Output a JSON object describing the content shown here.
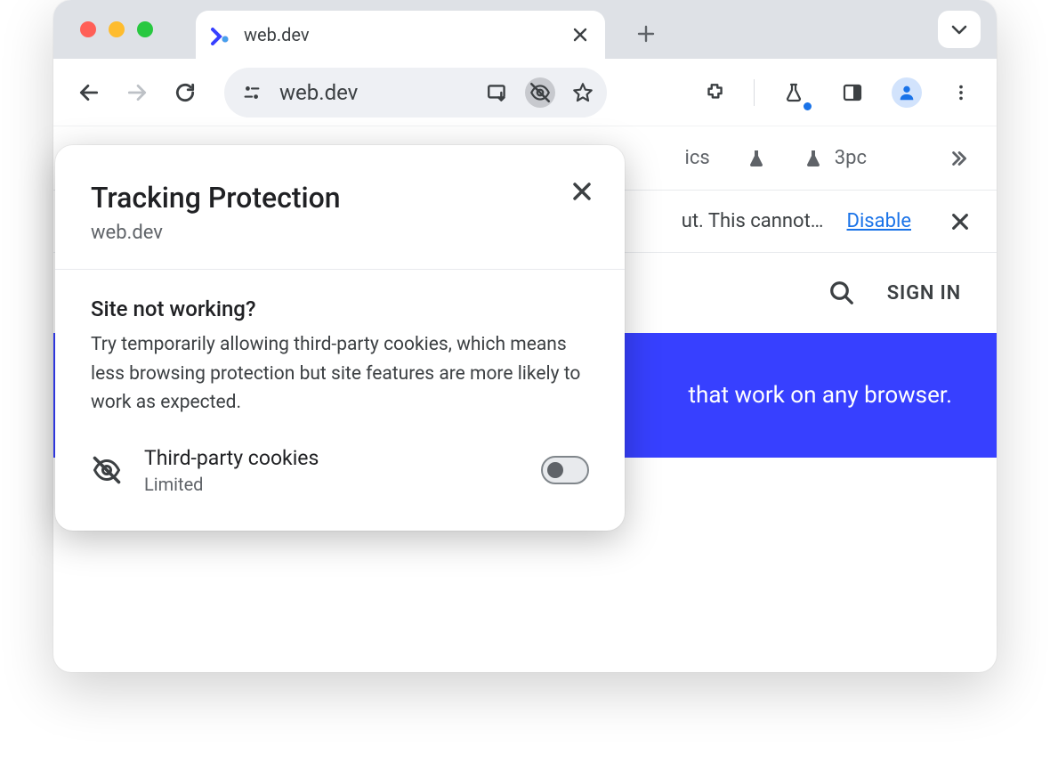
{
  "tab": {
    "title": "web.dev"
  },
  "omnibox": {
    "url": "web.dev"
  },
  "ext_bar": {
    "item1_suffix": "ics",
    "item2_label": "3pc"
  },
  "info_bar": {
    "text_fragment": "ut. This cannot…",
    "link_label": "Disable"
  },
  "site": {
    "signin_label": "SIGN IN",
    "banner_fragment": "that work on any browser."
  },
  "popover": {
    "title": "Tracking Protection",
    "site": "web.dev",
    "question": "Site not working?",
    "description": "Try temporarily allowing third-party cookies, which means less browsing protection but site features are more likely to work as expected.",
    "cookie_label": "Third-party cookies",
    "cookie_status": "Limited"
  }
}
